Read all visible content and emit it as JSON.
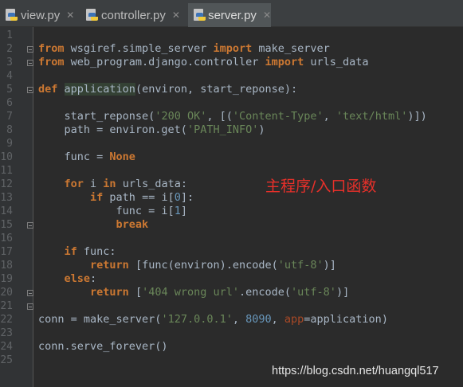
{
  "tabs": [
    {
      "label": "view.py",
      "active": false
    },
    {
      "label": "controller.py",
      "active": false
    },
    {
      "label": "server.py",
      "active": true
    }
  ],
  "line_numbers": [
    "1",
    "2",
    "3",
    "4",
    "5",
    "6",
    "7",
    "8",
    "9",
    "10",
    "11",
    "12",
    "13",
    "14",
    "15",
    "16",
    "17",
    "18",
    "19",
    "20",
    "21",
    "22",
    "23",
    "24",
    "25"
  ],
  "code_lines": [
    [],
    [
      {
        "t": "from",
        "c": "kw"
      },
      {
        "t": " wsgiref.simple_server "
      },
      {
        "t": "import",
        "c": "kw"
      },
      {
        "t": " make_server"
      }
    ],
    [
      {
        "t": "from",
        "c": "kw"
      },
      {
        "t": " web_program.django.controller "
      },
      {
        "t": "import",
        "c": "kw"
      },
      {
        "t": " urls_data"
      }
    ],
    [],
    [
      {
        "t": "def",
        "c": "kw"
      },
      {
        "t": " "
      },
      {
        "t": "application",
        "c": "hl"
      },
      {
        "t": "(environ, start_reponse):"
      }
    ],
    [],
    [
      {
        "t": "    start_reponse("
      },
      {
        "t": "'200 OK'",
        "c": "str"
      },
      {
        "t": ", [("
      },
      {
        "t": "'Content-Type'",
        "c": "str"
      },
      {
        "t": ", "
      },
      {
        "t": "'text/html'",
        "c": "str"
      },
      {
        "t": ")])"
      }
    ],
    [
      {
        "t": "    path = environ.get("
      },
      {
        "t": "'PATH_INFO'",
        "c": "str"
      },
      {
        "t": ")"
      }
    ],
    [],
    [
      {
        "t": "    func = "
      },
      {
        "t": "None",
        "c": "kw"
      }
    ],
    [],
    [
      {
        "t": "    "
      },
      {
        "t": "for",
        "c": "kw"
      },
      {
        "t": " i "
      },
      {
        "t": "in",
        "c": "kw"
      },
      {
        "t": " urls_data:"
      }
    ],
    [
      {
        "t": "        "
      },
      {
        "t": "if",
        "c": "kw"
      },
      {
        "t": " path == i["
      },
      {
        "t": "0",
        "c": "num"
      },
      {
        "t": "]:"
      }
    ],
    [
      {
        "t": "            func = i["
      },
      {
        "t": "1",
        "c": "num"
      },
      {
        "t": "]"
      }
    ],
    [
      {
        "t": "            "
      },
      {
        "t": "break",
        "c": "kw"
      }
    ],
    [],
    [
      {
        "t": "    "
      },
      {
        "t": "if",
        "c": "kw"
      },
      {
        "t": " func:"
      }
    ],
    [
      {
        "t": "        "
      },
      {
        "t": "return",
        "c": "kw"
      },
      {
        "t": " [func(environ).encode("
      },
      {
        "t": "'utf-8'",
        "c": "str"
      },
      {
        "t": ")]"
      }
    ],
    [
      {
        "t": "    "
      },
      {
        "t": "else",
        "c": "kw"
      },
      {
        "t": ":"
      }
    ],
    [
      {
        "t": "        "
      },
      {
        "t": "return",
        "c": "kw"
      },
      {
        "t": " ["
      },
      {
        "t": "'404 wrong url'",
        "c": "str"
      },
      {
        "t": ".encode("
      },
      {
        "t": "'utf-8'",
        "c": "str"
      },
      {
        "t": ")]"
      }
    ],
    [],
    [
      {
        "t": "conn = make_server("
      },
      {
        "t": "'127.0.0.1'",
        "c": "str"
      },
      {
        "t": ", "
      },
      {
        "t": "8090",
        "c": "num"
      },
      {
        "t": ", "
      },
      {
        "t": "app",
        "c": "param"
      },
      {
        "t": "=application)"
      }
    ],
    [],
    [
      {
        "t": "conn.serve_forever()"
      }
    ],
    []
  ],
  "annotation": "主程序/入口函数",
  "watermark": "https://blog.csdn.net/huangql517"
}
